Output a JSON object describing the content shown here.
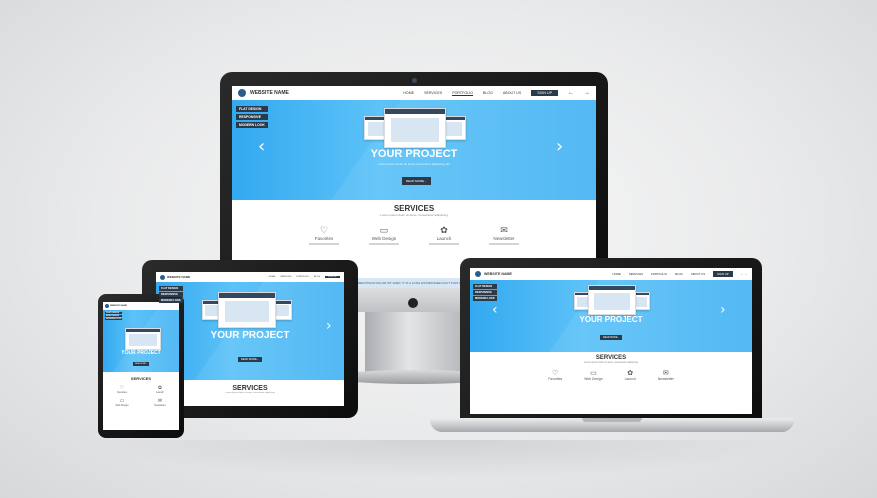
{
  "site": {
    "logo_text": "WEBSITE NAME",
    "nav": [
      "HOME",
      "SERVICES",
      "PORTFOLIO",
      "BLOG",
      "ABOUT US"
    ],
    "cta": "SIGN UP",
    "tags": [
      "FLAT DESIGN",
      "RESPONSIVE",
      "MODERN LOOK"
    ],
    "hero_title": "YOUR PROJECT",
    "hero_sub": "Lorem ipsum dolor sit amet consectetur adipiscing elit",
    "read_more": "READ MORE...",
    "services_title": "SERVICES",
    "services_sub": "Lorem ipsum dolor sit amet, consectetur adipiscing",
    "services": [
      {
        "name": "Favorites",
        "icon": "heart-icon"
      },
      {
        "name": "Web Design",
        "icon": "monitor-icon"
      },
      {
        "name": "Launch",
        "icon": "gear-icon"
      },
      {
        "name": "Newsletter",
        "icon": "envelope-icon"
      }
    ],
    "footer_strip": "LOREM IPSUM DOLOR SIT AMET, IT IS A LONG ESTABLISHED FACT THAT A READER"
  },
  "colors": {
    "hero": "#3aaef2",
    "dark": "#2b3a48",
    "bezel": "#111111",
    "silver": "#c9cbcd"
  }
}
